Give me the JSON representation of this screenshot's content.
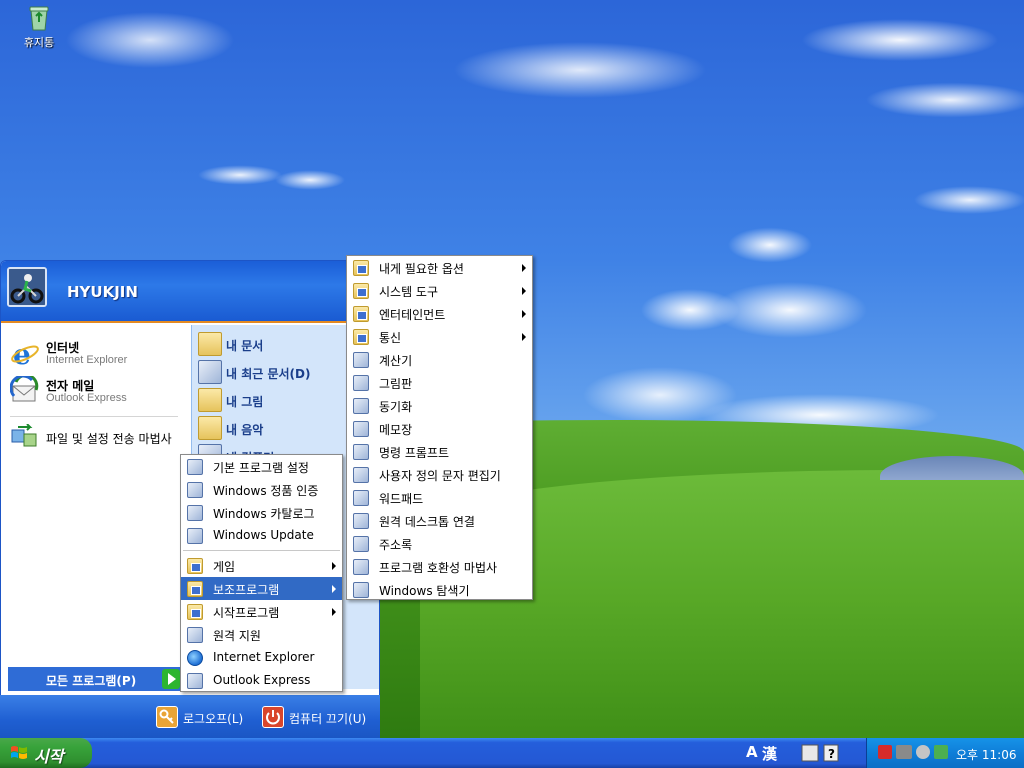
{
  "desktop": {
    "icons": [
      {
        "label": "휴지통",
        "icon": "recycle-bin-icon"
      }
    ]
  },
  "start_menu": {
    "user_name": "HYUKJIN",
    "pinned": [
      {
        "title": "인터넷",
        "subtitle": "Internet Explorer",
        "icon": "internet-explorer-icon"
      },
      {
        "title": "전자 메일",
        "subtitle": "Outlook Express",
        "icon": "outlook-express-icon"
      }
    ],
    "mfu": [
      {
        "label": "파일 및 설정 전송 마법사",
        "icon": "transfer-wizard-icon"
      }
    ],
    "right": [
      {
        "label": "내 문서",
        "icon": "my-documents-icon"
      },
      {
        "label": "내 최근 문서(D)",
        "icon": "recent-documents-icon"
      },
      {
        "label": "내 그림",
        "icon": "my-pictures-icon"
      },
      {
        "label": "내 음악",
        "icon": "my-music-icon"
      },
      {
        "label": "내 컴퓨터",
        "icon": "my-computer-icon"
      }
    ],
    "all_programs": "모든 프로그램(P)",
    "logoff": "로그오프(L)",
    "shutdown": "컴퓨터 끄기(U)"
  },
  "programs_menu": {
    "items": [
      {
        "label": "기본 프로그램 설정",
        "icon": "default-programs-icon",
        "submenu": false
      },
      {
        "label": "Windows 정품 인증",
        "icon": "windows-activation-icon",
        "submenu": false
      },
      {
        "label": "Windows 카탈로그",
        "icon": "windows-catalog-icon",
        "submenu": false
      },
      {
        "label": "Windows Update",
        "icon": "windows-update-icon",
        "submenu": false
      },
      {
        "label": "게임",
        "icon": "program-folder-icon",
        "submenu": true
      },
      {
        "label": "보조프로그램",
        "icon": "program-folder-icon",
        "submenu": true,
        "selected": true
      },
      {
        "label": "시작프로그램",
        "icon": "program-folder-icon",
        "submenu": true
      },
      {
        "label": "원격 지원",
        "icon": "remote-assistance-icon",
        "submenu": false
      },
      {
        "label": "Internet Explorer",
        "icon": "internet-explorer-icon",
        "submenu": false
      },
      {
        "label": "Outlook Express",
        "icon": "outlook-express-icon",
        "submenu": false
      }
    ]
  },
  "accessories_menu": {
    "items": [
      {
        "label": "내게 필요한 옵션",
        "icon": "program-folder-icon",
        "submenu": true
      },
      {
        "label": "시스템 도구",
        "icon": "program-folder-icon",
        "submenu": true
      },
      {
        "label": "엔터테인먼트",
        "icon": "program-folder-icon",
        "submenu": true
      },
      {
        "label": "통신",
        "icon": "program-folder-icon",
        "submenu": true
      },
      {
        "label": "계산기",
        "icon": "calculator-icon",
        "submenu": false
      },
      {
        "label": "그림판",
        "icon": "paint-icon",
        "submenu": false
      },
      {
        "label": "동기화",
        "icon": "synchronize-icon",
        "submenu": false
      },
      {
        "label": "메모장",
        "icon": "notepad-icon",
        "submenu": false
      },
      {
        "label": "명령 프롬프트",
        "icon": "command-prompt-icon",
        "submenu": false
      },
      {
        "label": "사용자 정의 문자 편집기",
        "icon": "character-editor-icon",
        "submenu": false
      },
      {
        "label": "워드패드",
        "icon": "wordpad-icon",
        "submenu": false
      },
      {
        "label": "원격 데스크톱 연결",
        "icon": "remote-desktop-icon",
        "submenu": false
      },
      {
        "label": "주소록",
        "icon": "address-book-icon",
        "submenu": false
      },
      {
        "label": "프로그램 호환성 마법사",
        "icon": "compatibility-wizard-icon",
        "submenu": false
      },
      {
        "label": "Windows 탐색기",
        "icon": "windows-explorer-icon",
        "submenu": false
      }
    ]
  },
  "taskbar": {
    "start_label": "시작",
    "language_bar": [
      "A",
      "漢"
    ],
    "clock": "오후 11:06"
  },
  "colors": {
    "start_green": "#38a33b",
    "taskbar_blue": "#2458d4",
    "menu_highlight": "#316ac5",
    "menu_header_blue": "#2d79e8",
    "accent_orange": "#e48a21"
  }
}
